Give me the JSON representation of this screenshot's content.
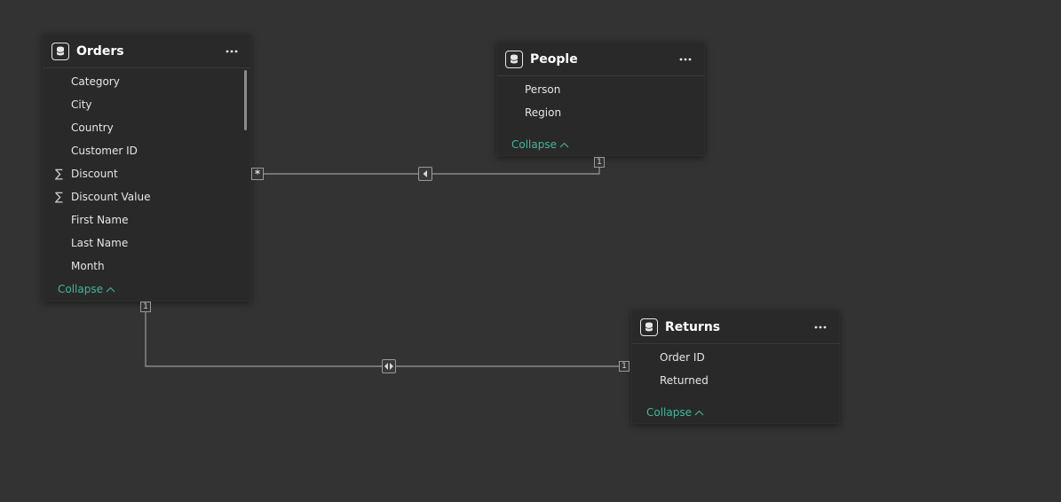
{
  "tables": [
    {
      "name": "Orders",
      "fields": [
        {
          "label": "Category",
          "sigma": ""
        },
        {
          "label": "City",
          "sigma": ""
        },
        {
          "label": "Country",
          "sigma": ""
        },
        {
          "label": "Customer ID",
          "sigma": ""
        },
        {
          "label": "Discount",
          "sigma": "∑"
        },
        {
          "label": "Discount Value",
          "sigma": "∑"
        },
        {
          "label": "First Name",
          "sigma": ""
        },
        {
          "label": "Last Name",
          "sigma": ""
        },
        {
          "label": "Month",
          "sigma": ""
        }
      ],
      "collapse_label": "Collapse"
    },
    {
      "name": "People",
      "fields": [
        {
          "label": "Person",
          "sigma": ""
        },
        {
          "label": "Region",
          "sigma": ""
        }
      ],
      "collapse_label": "Collapse"
    },
    {
      "name": "Returns",
      "fields": [
        {
          "label": "Order ID",
          "sigma": ""
        },
        {
          "label": "Returned",
          "sigma": ""
        }
      ],
      "collapse_label": "Collapse"
    }
  ],
  "relationships": [
    {
      "from_table": "Orders",
      "to_table": "People",
      "from_cardinality": "*",
      "to_cardinality": "1",
      "direction": "single"
    },
    {
      "from_table": "Orders",
      "to_table": "Returns",
      "from_cardinality": "1",
      "to_cardinality": "1",
      "direction": "both"
    }
  ],
  "colors": {
    "background": "#333333",
    "card": "#292929",
    "accent": "#3fb99a",
    "line": "#9a9a9a"
  },
  "icons": {
    "table": "database-icon",
    "more": "more-options-icon",
    "collapse": "chevron-up-icon"
  }
}
